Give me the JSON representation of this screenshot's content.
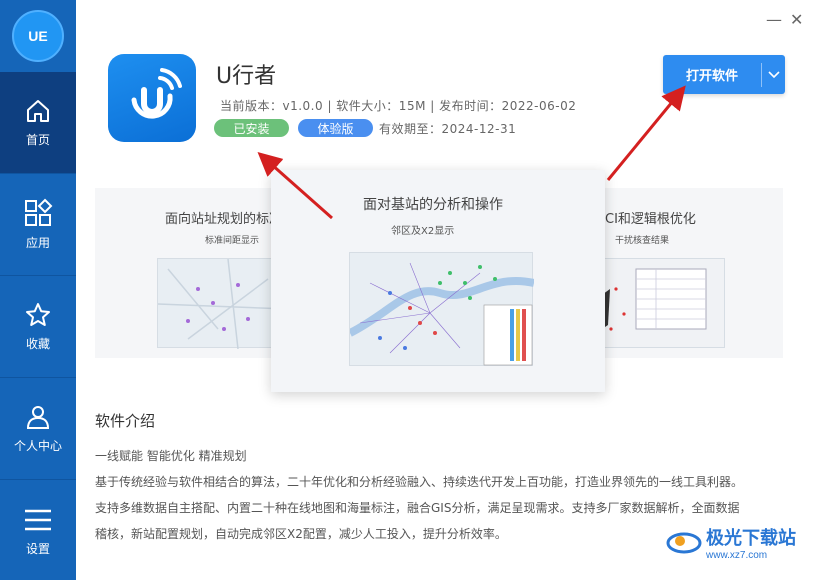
{
  "sidebar": {
    "avatar_text": "UE",
    "items": [
      {
        "label": "首页",
        "icon": "home-icon"
      },
      {
        "label": "应用",
        "icon": "apps-icon"
      },
      {
        "label": "收藏",
        "icon": "star-icon"
      },
      {
        "label": "个人中心",
        "icon": "user-icon"
      },
      {
        "label": "设置",
        "icon": "menu-icon"
      }
    ]
  },
  "window": {
    "minimize": "—",
    "close": "✕"
  },
  "app": {
    "name": "U行者",
    "meta": "当前版本：v1.0.0 | 软件大小：15M | 发布时间：2022-06-02",
    "tag_installed": "已安装",
    "tag_trial": "体验版",
    "expire": "有效期至：2024-12-31",
    "open_button": "打开软件"
  },
  "slides": {
    "left_title": "面向站址规划的标准",
    "left_sub": "标准间距显示",
    "center_title": "面对基站的分析和操作",
    "center_sub": "邻区及X2显示",
    "right_title": "CI和逻辑根优化",
    "right_sub": "干扰核查结果"
  },
  "intro": {
    "title": "软件介绍",
    "lines": [
      "一线赋能 智能优化 精准规划",
      "基于传统经验与软件相结合的算法，二十年优化和分析经验融入、持续迭代开发上百功能，打造业界领先的一线工具利器。",
      "支持多维数据自主搭配、内置二十种在线地图和海量标注，融合GIS分析，满足呈现需求。支持多厂家数据解析，全面数据",
      "稽核，新站配置规划，自动完成邻区X2配置，减少人工投入，提升分析效率。"
    ]
  },
  "watermark": {
    "text": "极光下载站",
    "url": "www.xz7.com"
  },
  "colors": {
    "sidebar": "#1565b8",
    "sidebar_active": "#0e3f80",
    "accent": "#2e8cf0",
    "installed": "#6cc17a",
    "trial": "#4a8ff0",
    "arrow": "#d42020"
  }
}
